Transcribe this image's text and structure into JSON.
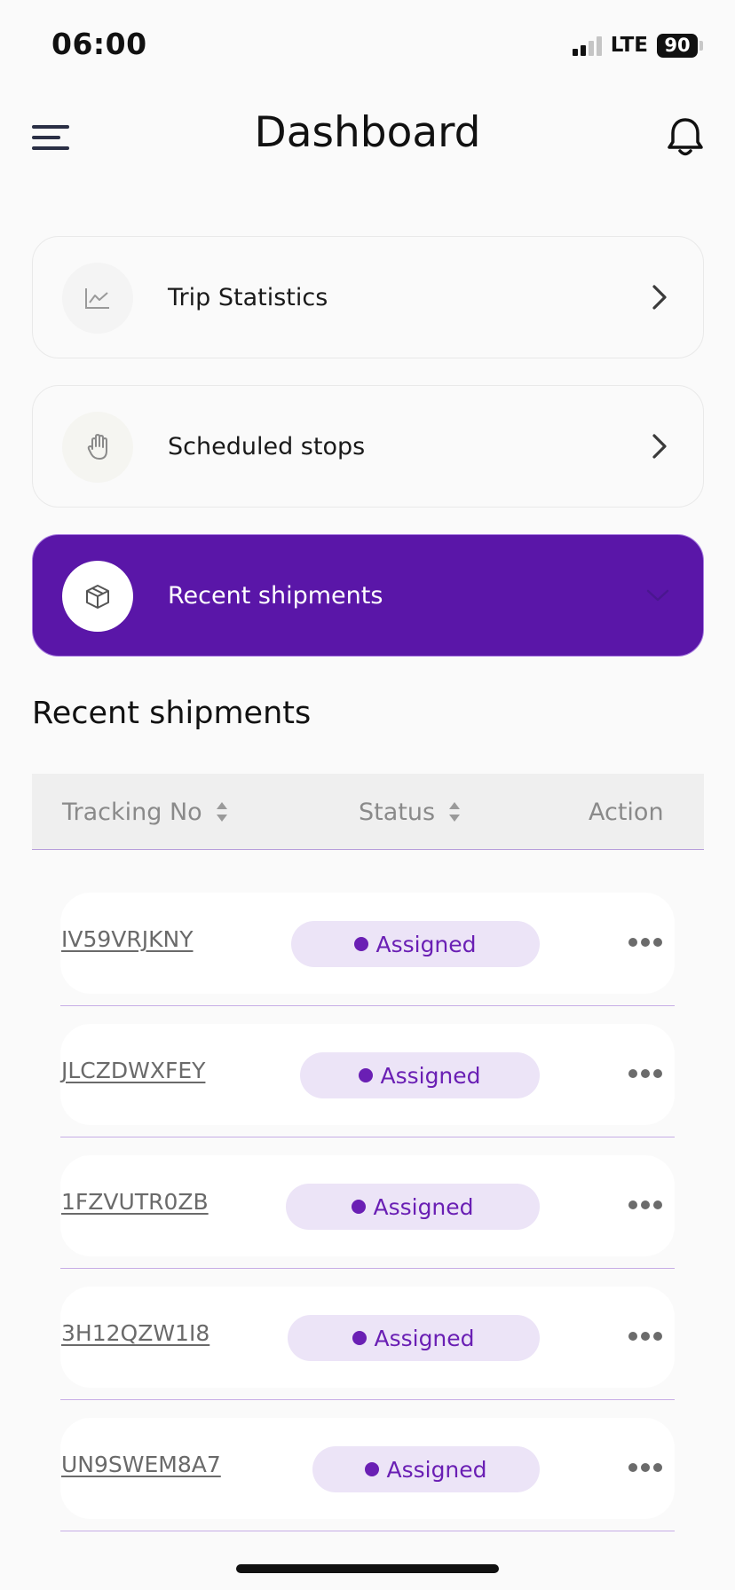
{
  "status_bar": {
    "time": "06:00",
    "network": "LTE",
    "battery": "90"
  },
  "header": {
    "title": "Dashboard"
  },
  "cards": [
    {
      "label": "Trip Statistics",
      "icon": "chart-line-icon"
    },
    {
      "label": "Scheduled stops",
      "icon": "hand-stop-icon"
    },
    {
      "label": "Recent shipments",
      "icon": "package-box-icon",
      "active": true
    }
  ],
  "section": {
    "title": "Recent shipments"
  },
  "table": {
    "columns": [
      "Tracking No",
      "Status",
      "Action"
    ],
    "rows": [
      {
        "tracking": "IV59VRJKNY",
        "status": "Assigned"
      },
      {
        "tracking": "JLCZDWXFEY",
        "status": "Assigned"
      },
      {
        "tracking": "1FZVUTR0ZB",
        "status": "Assigned"
      },
      {
        "tracking": "3H12QZW1I8",
        "status": "Assigned"
      },
      {
        "tracking": "UN9SWEM8A7",
        "status": "Assigned"
      }
    ]
  },
  "colors": {
    "accent": "#5a16a8",
    "status_text": "#6a1fb4",
    "status_bg": "#ece4f7"
  }
}
